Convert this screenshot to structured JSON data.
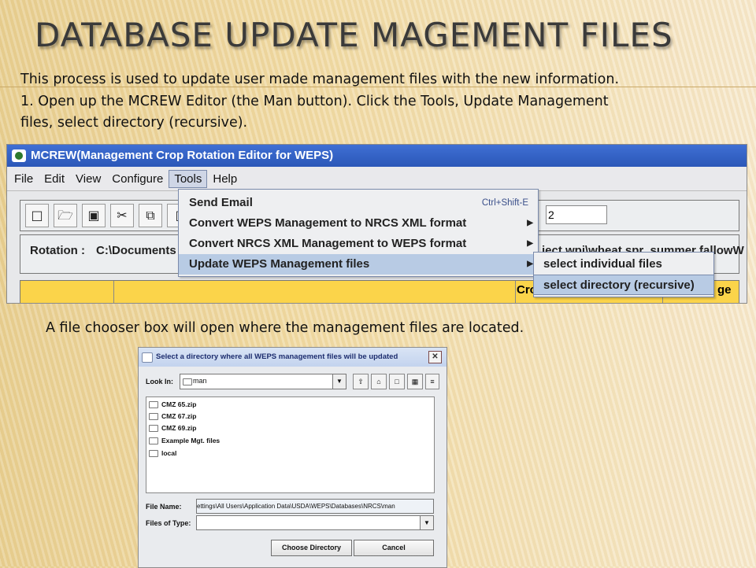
{
  "slide": {
    "title": "DATABASE UPDATE MAGEMENT FILES",
    "intro": [
      "This process is used to update user made management files with the new information.",
      "1. Open up the MCREW Editor (the Man button).  Click the Tools, Update Management",
      "files, select directory (recursive)."
    ],
    "caption": "A file chooser box will open where the management files are located."
  },
  "mcrew": {
    "title": "MCREW(Management Crop Rotation Editor for WEPS)",
    "menus": [
      "File",
      "Edit",
      "View",
      "Configure",
      "Tools",
      "Help"
    ],
    "active_menu": "Tools",
    "stepper_value": "2",
    "rotation_label": "Rotation :",
    "rotation_path": "C:\\Documents",
    "rotation_tail": "ject.wpj\\wheat.spr .summer fallowW",
    "grid_headers": [
      "Cro",
      "ge"
    ],
    "tools_menu": [
      {
        "label": "Send Email",
        "shortcut": "Ctrl+Shift-E",
        "submenu": false
      },
      {
        "label": "Convert WEPS Management to NRCS XML format",
        "shortcut": "",
        "submenu": true
      },
      {
        "label": "Convert NRCS XML Management to WEPS format",
        "shortcut": "",
        "submenu": true
      },
      {
        "label": "Update WEPS Management files",
        "shortcut": "",
        "submenu": true
      }
    ],
    "update_submenu": [
      "select individual files",
      "select directory (recursive)"
    ]
  },
  "chooser": {
    "title": "Select a directory where all WEPS management files will be updated",
    "look_in_label": "Look In:",
    "look_in_value": "man",
    "files": [
      "CMZ 65.zip",
      "CMZ 67.zip",
      "CMZ 69.zip",
      "Example Mgt. files",
      "local"
    ],
    "file_name_label": "File Name:",
    "file_name_value": "ettings\\All Users\\Application Data\\USDA\\WEPS\\Databases\\NRCS\\man",
    "files_of_type_label": "Files of Type:",
    "files_of_type_value": "",
    "choose_button": "Choose Directory",
    "cancel_button": "Cancel"
  },
  "colors": {
    "accent_title_bar": "#2b57b8",
    "grid_header": "#fbd44a",
    "menu_highlight": "#b8cbe4"
  }
}
